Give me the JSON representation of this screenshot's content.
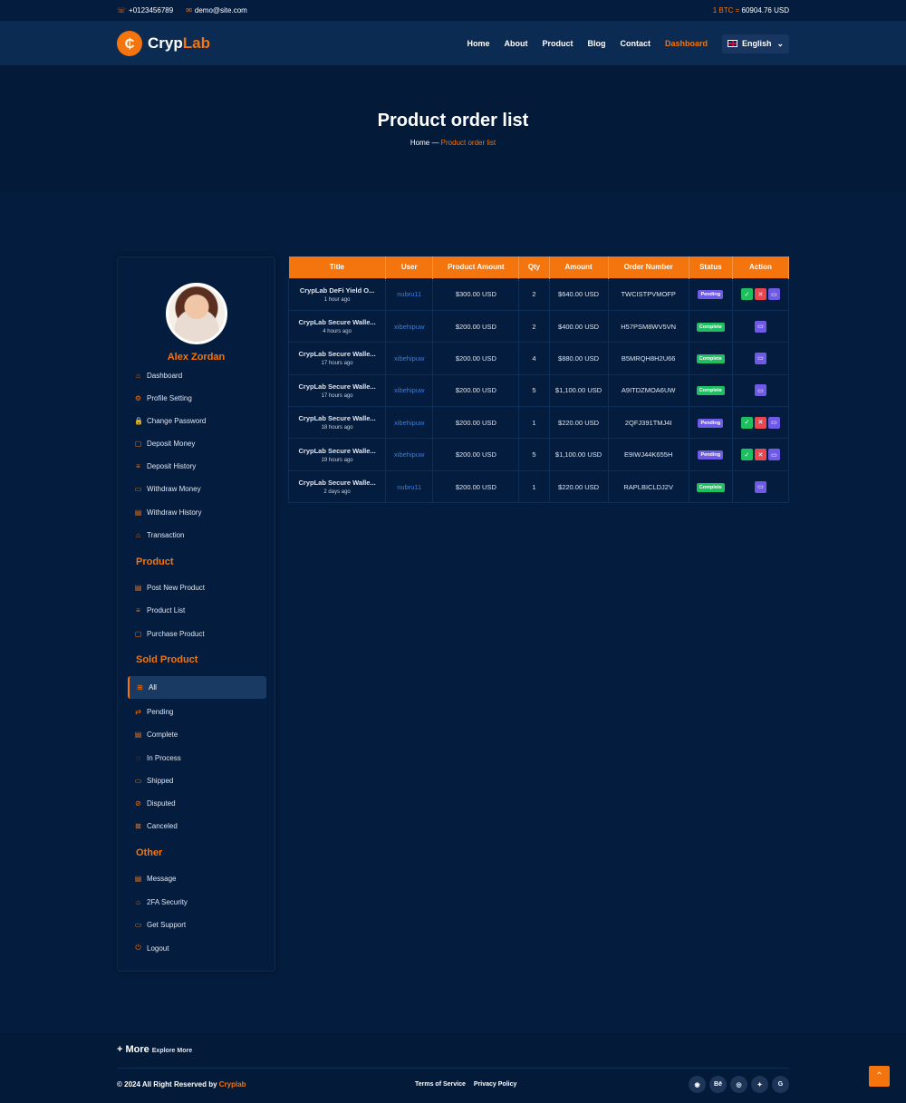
{
  "topbar": {
    "phone": "+0123456789",
    "email": "demo@site.com",
    "btc_label": "1 BTC =",
    "btc_value": "60904.76 USD"
  },
  "logo": {
    "part1": "Cryp",
    "part2": "Lab"
  },
  "nav": {
    "items": [
      "Home",
      "About",
      "Product",
      "Blog",
      "Contact",
      "Dashboard"
    ],
    "language": "English"
  },
  "hero": {
    "title": "Product order list",
    "crumb_home": "Home",
    "crumb_sep": "—",
    "crumb_current": "Product order list"
  },
  "profile": {
    "name": "Alex Zordan"
  },
  "sidebar": {
    "main": [
      {
        "icon": "⌂",
        "label": "Dashboard"
      },
      {
        "icon": "⚙",
        "label": "Profile Setting"
      },
      {
        "icon": "🔒",
        "label": "Change Password"
      },
      {
        "icon": "▢",
        "label": "Deposit Money"
      },
      {
        "icon": "≡",
        "label": "Deposit History"
      },
      {
        "icon": "▭",
        "label": "Withdraw Money"
      },
      {
        "icon": "▤",
        "label": "Withdraw History"
      },
      {
        "icon": "⌂",
        "label": "Transaction"
      }
    ],
    "product_title": "Product",
    "product": [
      {
        "icon": "▤",
        "label": "Post New Product"
      },
      {
        "icon": "≡",
        "label": "Product List"
      },
      {
        "icon": "▢",
        "label": "Purchase Product"
      }
    ],
    "sold_title": "Sold Product",
    "sold": [
      {
        "icon": "⊞",
        "label": "All"
      },
      {
        "icon": "⇄",
        "label": "Pending"
      },
      {
        "icon": "▤",
        "label": "Complete"
      },
      {
        "icon": "◌",
        "label": "In Process"
      },
      {
        "icon": "▭",
        "label": "Shipped"
      },
      {
        "icon": "⊘",
        "label": "Disputed"
      },
      {
        "icon": "⊠",
        "label": "Canceled"
      }
    ],
    "other_title": "Other",
    "other": [
      {
        "icon": "▤",
        "label": "Message"
      },
      {
        "icon": "⌂",
        "label": "2FA Security"
      },
      {
        "icon": "▭",
        "label": "Get Support"
      },
      {
        "icon": "⏻",
        "label": "Logout"
      }
    ]
  },
  "table": {
    "headers": [
      "Title",
      "User",
      "Product Amount",
      "Qty",
      "Amount",
      "Order Number",
      "Status",
      "Action"
    ],
    "rows": [
      {
        "title": "CrypLab DeFi Yield O...",
        "ago": "1 hour ago",
        "user": "nubru11",
        "pamount": "$300.00 USD",
        "qty": "2",
        "amount": "$640.00 USD",
        "order": "TWCISTPVMOFP",
        "status": "Pending"
      },
      {
        "title": "CrypLab Secure Walle...",
        "ago": "4 hours ago",
        "user": "xibehipuw",
        "pamount": "$200.00 USD",
        "qty": "2",
        "amount": "$400.00 USD",
        "order": "H57PSM8WV5VN",
        "status": "Complete"
      },
      {
        "title": "CrypLab Secure Walle...",
        "ago": "17 hours ago",
        "user": "xibehipuw",
        "pamount": "$200.00 USD",
        "qty": "4",
        "amount": "$880.00 USD",
        "order": "B5MRQH8H2U66",
        "status": "Complete"
      },
      {
        "title": "CrypLab Secure Walle...",
        "ago": "17 hours ago",
        "user": "xibehipuw",
        "pamount": "$200.00 USD",
        "qty": "5",
        "amount": "$1,100.00 USD",
        "order": "A9ITDZMOA6UW",
        "status": "Complete"
      },
      {
        "title": "CrypLab Secure Walle...",
        "ago": "18 hours ago",
        "user": "xibehipuw",
        "pamount": "$200.00 USD",
        "qty": "1",
        "amount": "$220.00 USD",
        "order": "2QFJ391TMJ4I",
        "status": "Pending"
      },
      {
        "title": "CrypLab Secure Walle...",
        "ago": "19 hours ago",
        "user": "xibehipuw",
        "pamount": "$200.00 USD",
        "qty": "5",
        "amount": "$1,100.00 USD",
        "order": "E9IWJ44K655H",
        "status": "Pending"
      },
      {
        "title": "CrypLab Secure Walle...",
        "ago": "2 days ago",
        "user": "nubru11",
        "pamount": "$200.00 USD",
        "qty": "1",
        "amount": "$220.00 USD",
        "order": "RAPLBICLDJ2V",
        "status": "Complete"
      }
    ]
  },
  "footer": {
    "more": "+ More",
    "explore": "Explore More",
    "copy": "© 2024 All Right Reserved by",
    "brand": "Cryplab",
    "terms": "Terms of Service",
    "privacy": "Privacy Policy",
    "social": [
      "◉",
      "Bē",
      "◎",
      "✦",
      "G"
    ]
  },
  "colors": {
    "accent": "#f4740e",
    "bg": "#041c3d",
    "pending": "#6f5ae6",
    "complete": "#1dbf60"
  }
}
